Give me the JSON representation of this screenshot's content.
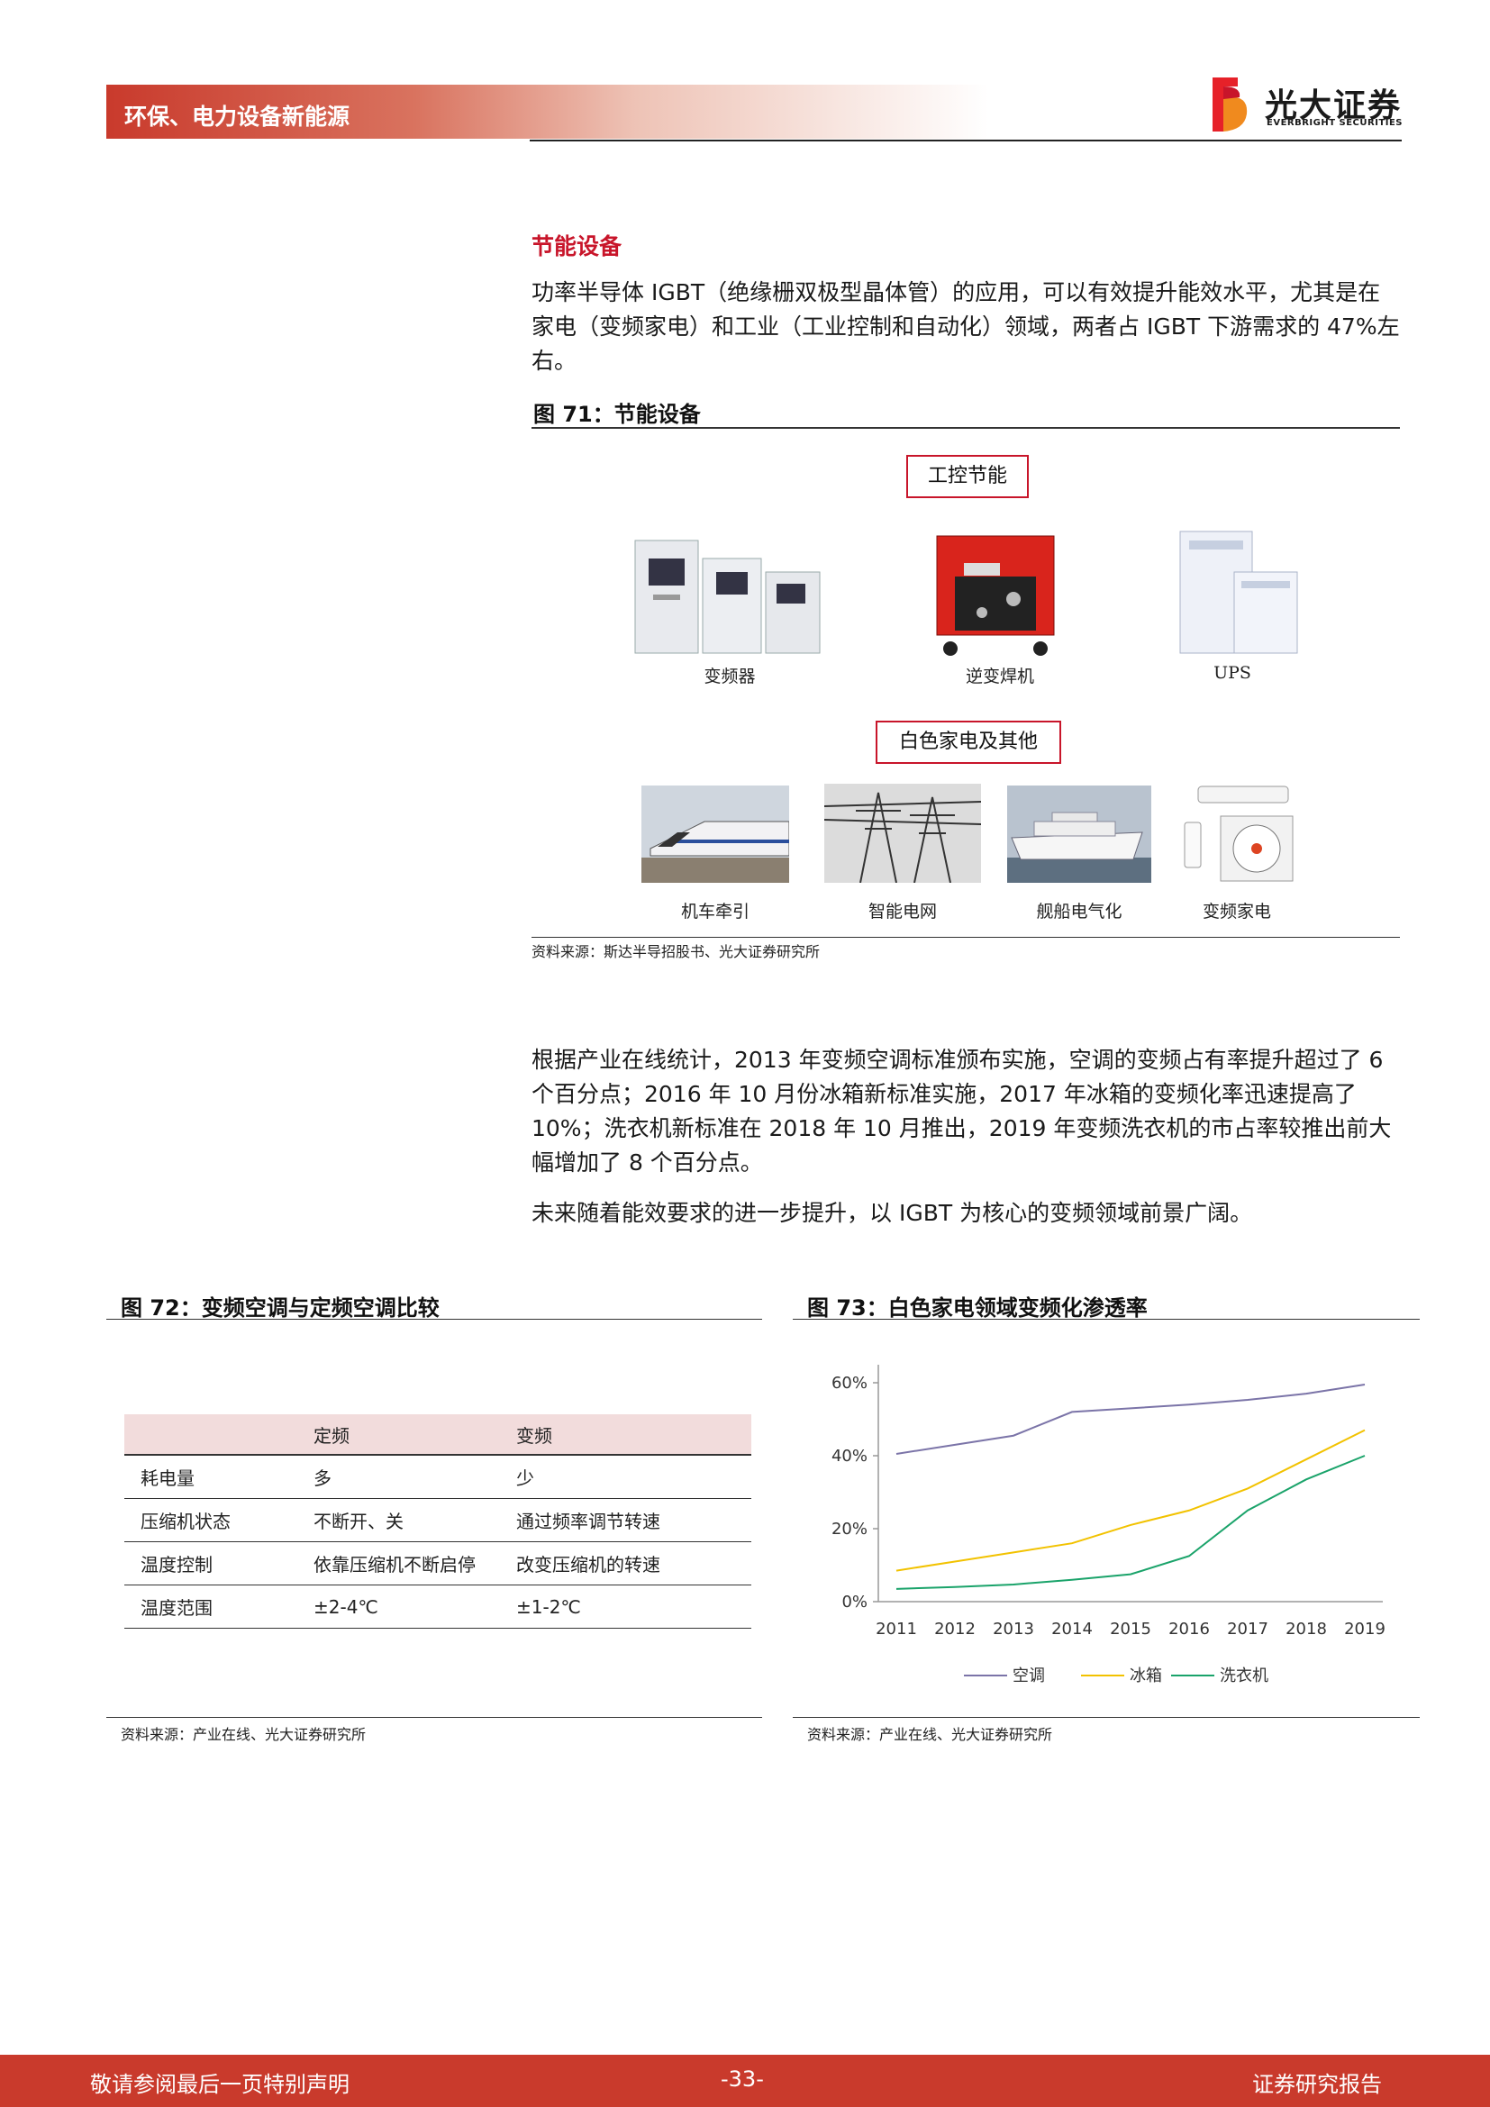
{
  "header": {
    "section": "环保、电力设备新能源",
    "logo_cn": "光大证券",
    "logo_en": "EVERBRIGHT SECURITIES"
  },
  "section_heading": "节能设备",
  "para1": "功率半导体 IGBT（绝缘栅双极型晶体管）的应用，可以有效提升能效水平，尤其是在家电（变频家电）和工业（工业控制和自动化）领域，两者占 IGBT 下游需求的 47%左右。",
  "fig71": {
    "title": "图 71：节能设备",
    "category1": "工控节能",
    "category2": "白色家电及其他",
    "row1_labels": [
      "变频器",
      "逆变焊机",
      "UPS"
    ],
    "row2_labels": [
      "机车牵引",
      "智能电网",
      "舰船电气化",
      "变频家电"
    ],
    "source": "资料来源：斯达半导招股书、光大证券研究所"
  },
  "para2": "根据产业在线统计，2013 年变频空调标准颁布实施，空调的变频占有率提升超过了 6 个百分点；2016 年 10 月份冰箱新标准实施，2017 年冰箱的变频化率迅速提高了 10%；洗衣机新标准在 2018 年 10 月推出，2019 年变频洗衣机的市占率较推出前大幅增加了 8 个百分点。",
  "para3": "未来随着能效要求的进一步提升，以 IGBT 为核心的变频领域前景广阔。",
  "fig72": {
    "title": "图 72：变频空调与定频空调比较",
    "headers": [
      "",
      "定频",
      "变频"
    ],
    "rows": [
      [
        "耗电量",
        "多",
        "少"
      ],
      [
        "压缩机状态",
        "不断开、关",
        "通过频率调节转速"
      ],
      [
        "温度控制",
        "依靠压缩机不断启停",
        "改变压缩机的转速"
      ],
      [
        "温度范围",
        "±2-4℃",
        "±1-2℃"
      ]
    ],
    "source": "资料来源：产业在线、光大证券研究所"
  },
  "fig73": {
    "title": "图 73：白色家电领域变频化渗透率",
    "source": "资料来源：产业在线、光大证券研究所"
  },
  "chart_data": {
    "type": "line",
    "title": "",
    "xlabel": "",
    "ylabel": "",
    "x": [
      "2011",
      "2012",
      "2013",
      "2014",
      "2015",
      "2016",
      "2017",
      "2018",
      "2019"
    ],
    "ylim": [
      0,
      0.6
    ],
    "yticks": [
      "0%",
      "20%",
      "40%",
      "60%"
    ],
    "legend_position": "bottom",
    "grid": false,
    "series": [
      {
        "name": "空调",
        "color": "#7b74a8",
        "values": [
          0.405,
          0.43,
          0.455,
          0.52,
          0.53,
          0.54,
          0.553,
          0.57,
          0.595
        ]
      },
      {
        "name": "冰箱",
        "color": "#f2c200",
        "values": [
          0.085,
          0.11,
          0.135,
          0.16,
          0.21,
          0.25,
          0.31,
          0.39,
          0.47
        ]
      },
      {
        "name": "洗衣机",
        "color": "#1aa36a",
        "values": [
          0.035,
          0.04,
          0.047,
          0.06,
          0.075,
          0.125,
          0.25,
          0.335,
          0.4
        ]
      }
    ]
  },
  "footer": {
    "left": "敬请参阅最后一页特别声明",
    "page": "-33-",
    "right": "证券研究报告"
  }
}
